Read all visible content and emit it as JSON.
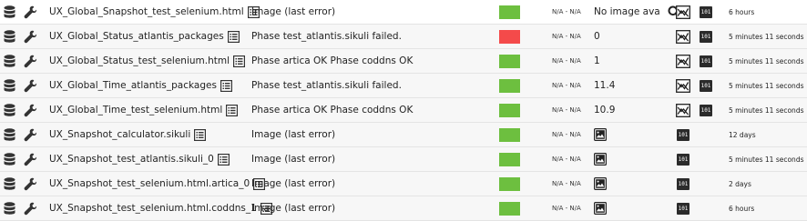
{
  "colors": {
    "ok": "#6dbf3f",
    "critical": "#f44a4a"
  },
  "rows": [
    {
      "name": "UX_Global_Snapshot_test_selenium.html",
      "status": "Image (last error)",
      "state": "ok",
      "thresholds": "N/A - N/A",
      "value": "No image ava",
      "value_icon": "magnifier-icon",
      "graph": true,
      "raw": "101",
      "time": "6 hours"
    },
    {
      "name": "UX_Global_Status_atlantis_packages",
      "status": "Phase test_atlantis.sikuli failed.",
      "state": "critical",
      "thresholds": "N/A - N/A",
      "value": "0",
      "graph": true,
      "raw": "101",
      "time": "5 minutes 11 seconds"
    },
    {
      "name": "UX_Global_Status_test_selenium.html",
      "status": "Phase artica OK Phase coddns OK",
      "state": "ok",
      "thresholds": "N/A - N/A",
      "value": "1",
      "graph": true,
      "raw": "101",
      "time": "5 minutes 11 seconds"
    },
    {
      "name": "UX_Global_Time_atlantis_packages",
      "status": "Phase test_atlantis.sikuli failed.",
      "state": "ok",
      "thresholds": "N/A - N/A",
      "value": "11.4",
      "graph": true,
      "raw": "101",
      "time": "5 minutes 11 seconds"
    },
    {
      "name": "UX_Global_Time_test_selenium.html",
      "status": "Phase artica OK Phase coddns OK",
      "state": "ok",
      "thresholds": "N/A - N/A",
      "value": "10.9",
      "graph": true,
      "raw": "101",
      "time": "5 minutes 11 seconds"
    },
    {
      "name": "UX_Snapshot_calculator.sikuli",
      "status": "Image (last error)",
      "state": "ok",
      "thresholds": "N/A - N/A",
      "value": "",
      "image": true,
      "graph": false,
      "raw": "101",
      "time": "12 days"
    },
    {
      "name": "UX_Snapshot_test_atlantis.sikuli_0",
      "status": "Image (last error)",
      "state": "ok",
      "thresholds": "N/A - N/A",
      "value": "",
      "image": true,
      "graph": false,
      "raw": "101",
      "time": "5 minutes 11 seconds"
    },
    {
      "name": "UX_Snapshot_test_selenium.html.artica_0",
      "status": "Image (last error)",
      "state": "ok",
      "thresholds": "N/A - N/A",
      "value": "",
      "image": true,
      "graph": false,
      "raw": "101",
      "time": "2 days"
    },
    {
      "name": "UX_Snapshot_test_selenium.html.coddns_1",
      "status": "Image (last error)",
      "state": "ok",
      "thresholds": "N/A - N/A",
      "value": "",
      "image": true,
      "graph": false,
      "raw": "101",
      "time": "6 hours"
    }
  ]
}
